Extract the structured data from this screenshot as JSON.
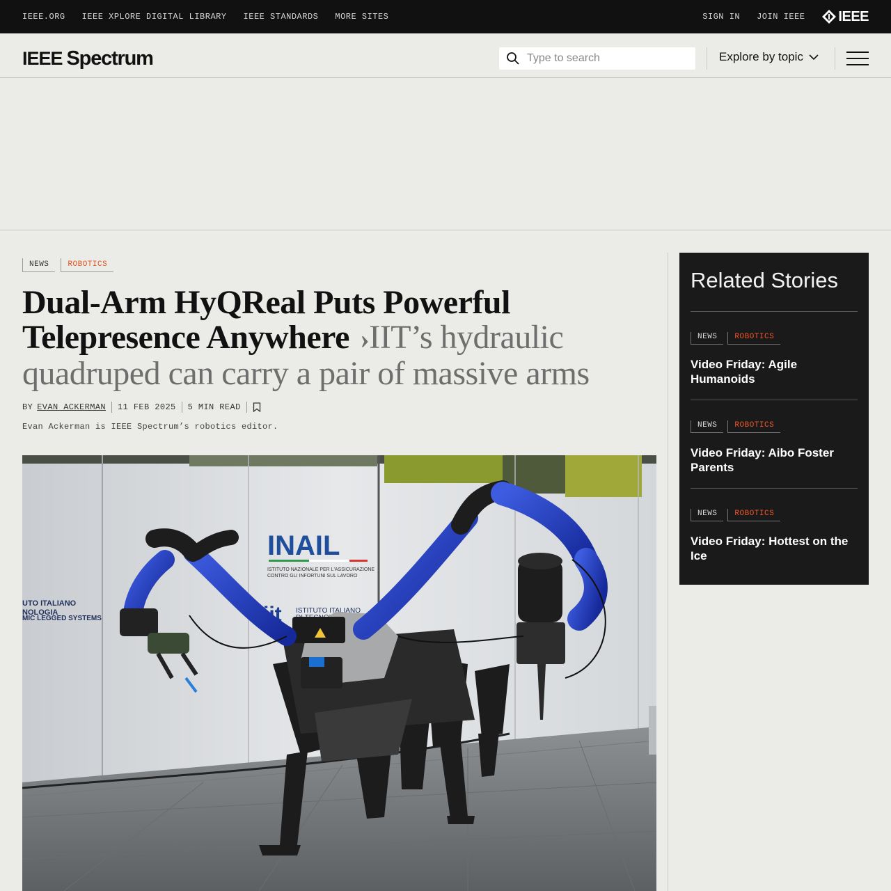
{
  "topbar": {
    "links": [
      "IEEE.ORG",
      "IEEE XPLORE DIGITAL LIBRARY",
      "IEEE STANDARDS",
      "MORE SITES"
    ],
    "sign_in": "SIGN IN",
    "join": "JOIN IEEE",
    "logo_text": "IEEE"
  },
  "header": {
    "brand_ieee": "IEEE",
    "brand_spectrum": "Spectrum",
    "search_placeholder": "Type to search",
    "explore_label": "Explore by topic"
  },
  "article": {
    "tags": [
      "NEWS",
      "ROBOTICS"
    ],
    "headline": "Dual-Arm HyQReal Puts Powerful Telepresence Anywhere",
    "deck": "IIT’s hydraulic quadruped can carry a pair of massive arms",
    "by": "BY",
    "author": "EVAN ACKERMAN",
    "date": "11 FEB 2025",
    "read_time": "5 MIN READ",
    "bio": "Evan Ackerman is IEEE Spectrum’s robotics editor.",
    "photo_text": {
      "sign1": "INAIL",
      "sign1_sub1": "ISTITUTO NAZIONALE PER L'ASSICURAZIONE",
      "sign1_sub2": "CONTRO GLI INFORTUNI SUL LAVORO",
      "sign2_l1": "UTO ITALIANO",
      "sign2_l2": "NOLOGIA",
      "sign2_l3": "MIC LEGGED SYSTEMS",
      "sign3_l1": "ISTITUTO ITALIANO",
      "sign3_l2": "DI TECNOLOGIA",
      "iit": "iit"
    }
  },
  "related": {
    "heading": "Related Stories",
    "items": [
      {
        "tags": [
          "NEWS",
          "ROBOTICS"
        ],
        "title": "Video Friday: Agile Humanoids"
      },
      {
        "tags": [
          "NEWS",
          "ROBOTICS"
        ],
        "title": "Video Friday: Aibo Foster Parents"
      },
      {
        "tags": [
          "NEWS",
          "ROBOTICS"
        ],
        "title": "Video Friday: Hottest on the Ice"
      }
    ]
  },
  "colors": {
    "accent": "#e4521c",
    "topbar": "#111111",
    "page_bg": "#ebebe7",
    "related_bg": "#1a1a1a",
    "robot_blue": "#1f3fb8"
  }
}
